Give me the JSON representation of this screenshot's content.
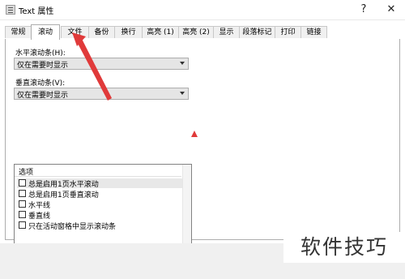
{
  "window": {
    "title": "Text 属性",
    "help_glyph": "?",
    "close_glyph": "✕"
  },
  "tabs": [
    {
      "label": "常规"
    },
    {
      "label": "滚动"
    },
    {
      "label": "文件"
    },
    {
      "label": "备份"
    },
    {
      "label": "换行"
    },
    {
      "label": "高亮 (1)"
    },
    {
      "label": "高亮 (2)"
    },
    {
      "label": "显示"
    },
    {
      "label": "段落标记"
    },
    {
      "label": "打印"
    },
    {
      "label": "链接"
    }
  ],
  "active_tab": "滚动",
  "scroll": {
    "horizontal": {
      "label": "水平滚动条(H):",
      "value": "仅在需要时显示"
    },
    "vertical": {
      "label": "垂直滚动条(V):",
      "value": "仅在需要时显示"
    }
  },
  "options": {
    "header": "选项",
    "items": [
      {
        "label": "总是启用1页水平滚动",
        "checked": false
      },
      {
        "label": "总是启用1页垂直滚动",
        "checked": false
      },
      {
        "label": "水平线",
        "checked": false
      },
      {
        "label": "垂直线",
        "checked": false
      },
      {
        "label": "只在活动窗格中显示滚动条",
        "checked": false
      }
    ]
  },
  "watermark": "软件技巧",
  "colors": {
    "annotation": "#e03a3a"
  }
}
